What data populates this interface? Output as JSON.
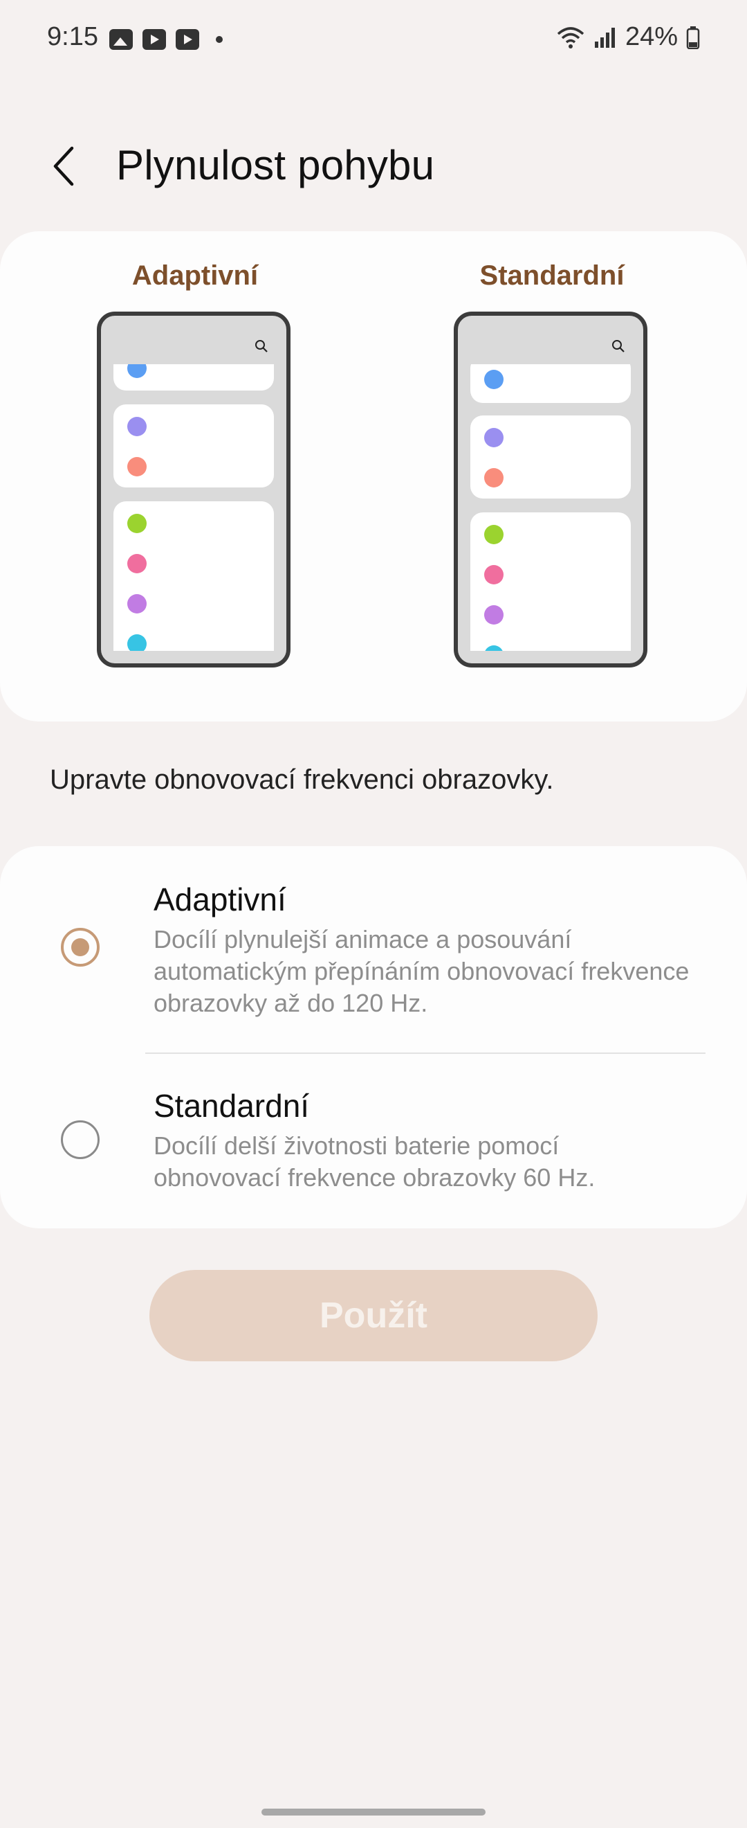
{
  "status_bar": {
    "time": "9:15",
    "battery": "24%",
    "icons": [
      "gallery-icon",
      "youtube-icon",
      "youtube-icon",
      "dot-icon",
      "wifi-icon",
      "signal-icon",
      "battery-icon"
    ]
  },
  "header": {
    "title": "Plynulost pohybu",
    "back_icon": "chevron-left-icon"
  },
  "preview": {
    "adaptive_label": "Adaptivní",
    "standard_label": "Standardní",
    "dot_colors": [
      "#5b9ef3",
      "#9a8ff0",
      "#f98d7c",
      "#9bd32f",
      "#f06e9e",
      "#c17ce3",
      "#37c4e4"
    ]
  },
  "description": "Upravte obnovovací frekvenci obrazovky.",
  "options": [
    {
      "title": "Adaptivní",
      "subtitle": "Docílí plynulejší animace a posouvání automatickým přepínáním obnovovací frekvence obrazovky až do 120 Hz.",
      "selected": true
    },
    {
      "title": "Standardní",
      "subtitle": "Docílí delší životnosti baterie pomocí obnovovací frekvence obrazovky 60 Hz.",
      "selected": false
    }
  ],
  "apply_button": {
    "label": "Použít",
    "enabled": false
  },
  "colors": {
    "background": "#f5f1f0",
    "card": "#fdfdfd",
    "accent": "#c69a76",
    "label_brown": "#7d4f2b",
    "button_disabled": "#e7d2c4"
  }
}
